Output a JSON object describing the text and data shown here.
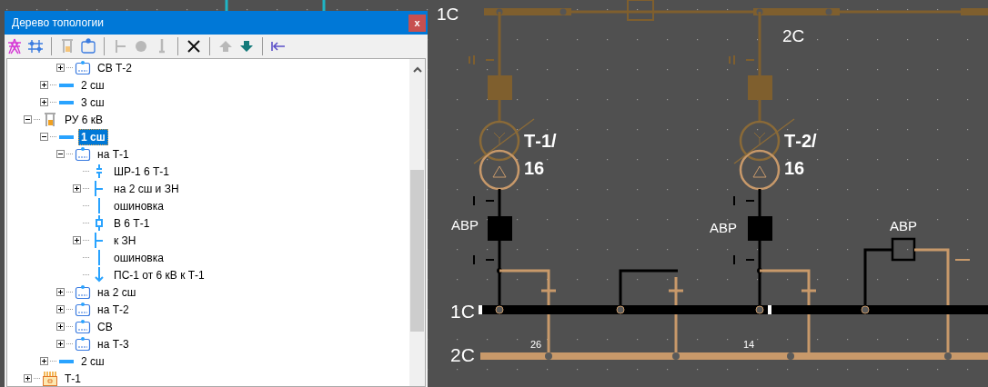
{
  "window": {
    "title": "Дерево топологии",
    "close": "x"
  },
  "toolbar": [
    [
      {
        "kind": "tower",
        "disabled": false
      },
      {
        "kind": "grid",
        "disabled": false
      }
    ],
    [
      {
        "kind": "switchgear",
        "disabled": true
      },
      {
        "kind": "cell",
        "disabled": false
      }
    ],
    [
      {
        "kind": "tee",
        "disabled": true
      },
      {
        "kind": "dot",
        "disabled": true
      },
      {
        "kind": "ground",
        "disabled": true
      }
    ],
    [
      {
        "kind": "delete",
        "disabled": false
      }
    ],
    [
      {
        "kind": "up",
        "disabled": true
      },
      {
        "kind": "down",
        "disabled": false
      }
    ],
    [
      {
        "kind": "collapse",
        "disabled": false
      }
    ]
  ],
  "tree": {
    "items": [
      {
        "children": [
          {
            "children": [
              {
                "label": "СВ Т-2",
                "kind": "cell",
                "expanded": false,
                "selected": false
              }
            ]
          },
          {
            "label": "2 сш",
            "kind": "busbar",
            "expanded": false,
            "selected": false
          },
          {
            "label": "3 сш",
            "kind": "busbar",
            "expanded": false,
            "selected": false
          }
        ]
      },
      {
        "label": "РУ 6 кВ",
        "kind": "switchgear",
        "expanded": true,
        "selected": false,
        "children": [
          {
            "label": "1 сш",
            "kind": "busbar",
            "expanded": true,
            "selected": true,
            "children": [
              {
                "label": "на Т-1",
                "kind": "cell",
                "expanded": true,
                "selected": false,
                "children": [
                  {
                    "label": "ШР-1 6 Т-1",
                    "kind": "disconnector",
                    "selected": false
                  },
                  {
                    "label": "на 2 сш и ЗН",
                    "kind": "branch",
                    "expanded": false,
                    "selected": false
                  },
                  {
                    "label": "ошиновка",
                    "kind": "line",
                    "selected": false
                  },
                  {
                    "label": "В 6 Т-1",
                    "kind": "breaker",
                    "selected": false
                  },
                  {
                    "label": "к ЗН",
                    "kind": "branch",
                    "expanded": false,
                    "selected": false
                  },
                  {
                    "label": "ошиновка",
                    "kind": "line",
                    "selected": false
                  },
                  {
                    "label": "ПС-1 от 6 кВ к Т-1",
                    "kind": "arrow",
                    "selected": false
                  }
                ]
              },
              {
                "label": "на 2 сш",
                "kind": "cell",
                "expanded": false,
                "selected": false
              },
              {
                "label": "на Т-2",
                "kind": "cell",
                "expanded": false,
                "selected": false
              },
              {
                "label": "СВ",
                "kind": "cell",
                "expanded": false,
                "selected": false
              },
              {
                "label": "на Т-3",
                "kind": "cell",
                "expanded": false,
                "selected": false
              }
            ]
          },
          {
            "label": "2 сш",
            "kind": "busbar",
            "expanded": false,
            "selected": false
          }
        ]
      },
      {
        "label": "Т-1",
        "kind": "transformer",
        "expanded": false,
        "selected": false
      }
    ]
  },
  "canvas": {
    "top_buses": [
      "1С",
      "2С"
    ],
    "transformers": [
      {
        "name": "Т-1/",
        "rating": "16"
      },
      {
        "name": "Т-2/",
        "rating": "16"
      }
    ],
    "avr_labels": [
      "АВР",
      "АВР",
      "АВР"
    ],
    "bottom_buses": [
      "1С",
      "2С"
    ],
    "counts": [
      "26",
      "14"
    ]
  }
}
